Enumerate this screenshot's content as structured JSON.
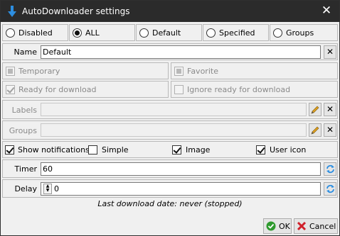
{
  "window": {
    "title": "AutoDownloader settings"
  },
  "mode_options": [
    {
      "label": "Disabled",
      "checked": false
    },
    {
      "label": "ALL",
      "checked": true
    },
    {
      "label": "Default",
      "checked": false
    },
    {
      "label": "Specified",
      "checked": false
    },
    {
      "label": "Groups",
      "checked": false
    }
  ],
  "name_field": {
    "label": "Name",
    "value": "Default"
  },
  "flags": {
    "temporary": "Temporary",
    "favorite": "Favorite",
    "ready_for_download": "Ready for download",
    "ignore_ready": "Ignore ready for download"
  },
  "labels_field": {
    "label": "Labels",
    "value": ""
  },
  "groups_field": {
    "label": "Groups",
    "value": ""
  },
  "notifications": {
    "show_notifications": "Show notifications",
    "simple": "Simple",
    "image": "Image",
    "user_icon": "User icon"
  },
  "timer_field": {
    "label": "Timer",
    "value": "60"
  },
  "delay_field": {
    "label": "Delay",
    "value": "0"
  },
  "status_text": "Last download date: never (stopped)",
  "buttons": {
    "ok": "OK",
    "cancel": "Cancel"
  },
  "colors": {
    "titlebar": "#2b2b2b",
    "ok_green": "#2e9a2e",
    "cancel_red": "#d0202a",
    "arrow_blue": "#2d8ee0"
  }
}
